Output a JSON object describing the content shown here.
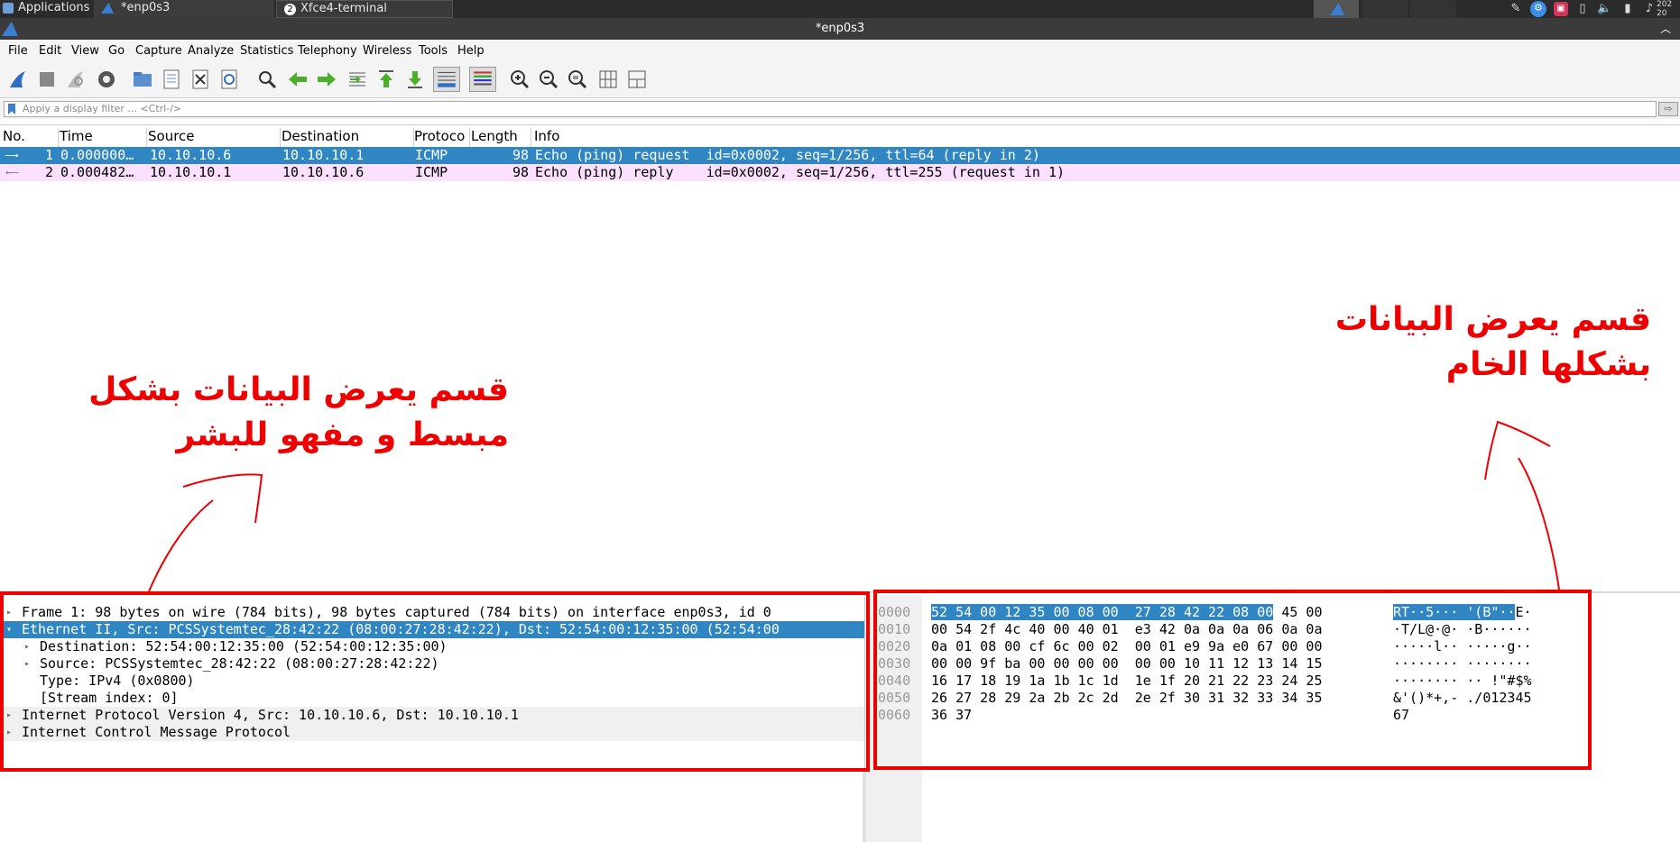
{
  "taskbar": {
    "applications": "Applications",
    "tasks": [
      {
        "label": "*enp0s3",
        "icon": "wireshark-fin-icon"
      },
      {
        "label": "Xfce4-terminal",
        "icon": "terminal-icon",
        "badge": "2"
      }
    ],
    "clock_line1": "202",
    "clock_line2": "20"
  },
  "window": {
    "title": "*enp0s3"
  },
  "menu": [
    "File",
    "Edit",
    "View",
    "Go",
    "Capture",
    "Analyze",
    "Statistics",
    "Telephony",
    "Wireless",
    "Tools",
    "Help"
  ],
  "filter": {
    "placeholder": "Apply a display filter ... <Ctrl-/>"
  },
  "packet_list": {
    "columns": [
      "No.",
      "Time",
      "Source",
      "Destination",
      "Protoco",
      "Length",
      "Info"
    ],
    "rows": [
      {
        "no": "1",
        "time": "0.000000…",
        "source": "10.10.10.6",
        "destination": "10.10.10.1",
        "protocol": "ICMP",
        "length": "98",
        "info": "Echo (ping) request  id=0x0002, seq=1/256, ttl=64 (reply in 2)"
      },
      {
        "no": "2",
        "time": "0.000482…",
        "source": "10.10.10.1",
        "destination": "10.10.10.6",
        "protocol": "ICMP",
        "length": "98",
        "info": "Echo (ping) reply    id=0x0002, seq=1/256, ttl=255 (request in 1)"
      }
    ]
  },
  "annotations": {
    "left_line1": "قسم يعرض البيانات بشكل",
    "left_line2": "مبسط و مفهو للبشر",
    "right_line1": "قسم يعرض البيانات",
    "right_line2": "بشكلها الخام"
  },
  "details": [
    "Frame 1: 98 bytes on wire (784 bits), 98 bytes captured (784 bits) on interface enp0s3, id 0",
    "Ethernet II, Src: PCSSystemtec_28:42:22 (08:00:27:28:42:22), Dst: 52:54:00:12:35:00 (52:54:00",
    "Destination: 52:54:00:12:35:00 (52:54:00:12:35:00)",
    "Source: PCSSystemtec_28:42:22 (08:00:27:28:42:22)",
    "Type: IPv4 (0x0800)",
    "[Stream index: 0]",
    "Internet Protocol Version 4, Src: 10.10.10.6, Dst: 10.10.10.1",
    "Internet Control Message Protocol"
  ],
  "hex": {
    "offsets": [
      "0000",
      "0010",
      "0020",
      "0030",
      "0040",
      "0050",
      "0060"
    ],
    "bytes_sel": "52 54 00 12 35 00 08 00  27 28 42 22 08 00",
    "bytes_rest0": " 45 00",
    "bytes": [
      "",
      "00 54 2f 4c 40 00 40 01  e3 42 0a 0a 0a 06 0a 0a",
      "0a 01 08 00 cf 6c 00 02  00 01 e9 9a e0 67 00 00",
      "00 00 9f ba 00 00 00 00  00 00 10 11 12 13 14 15",
      "16 17 18 19 1a 1b 1c 1d  1e 1f 20 21 22 23 24 25",
      "26 27 28 29 2a 2b 2c 2d  2e 2f 30 31 32 33 34 35",
      "36 37"
    ],
    "ascii_sel": "RT··5··· '(B\"··",
    "ascii_rest0": "E·",
    "ascii": [
      "",
      "·T/L@·@· ·B······",
      "·····l·· ·····g··",
      "········ ········",
      "········ ·· !\"#$%",
      "&'()*+,- ./012345",
      "67"
    ]
  }
}
